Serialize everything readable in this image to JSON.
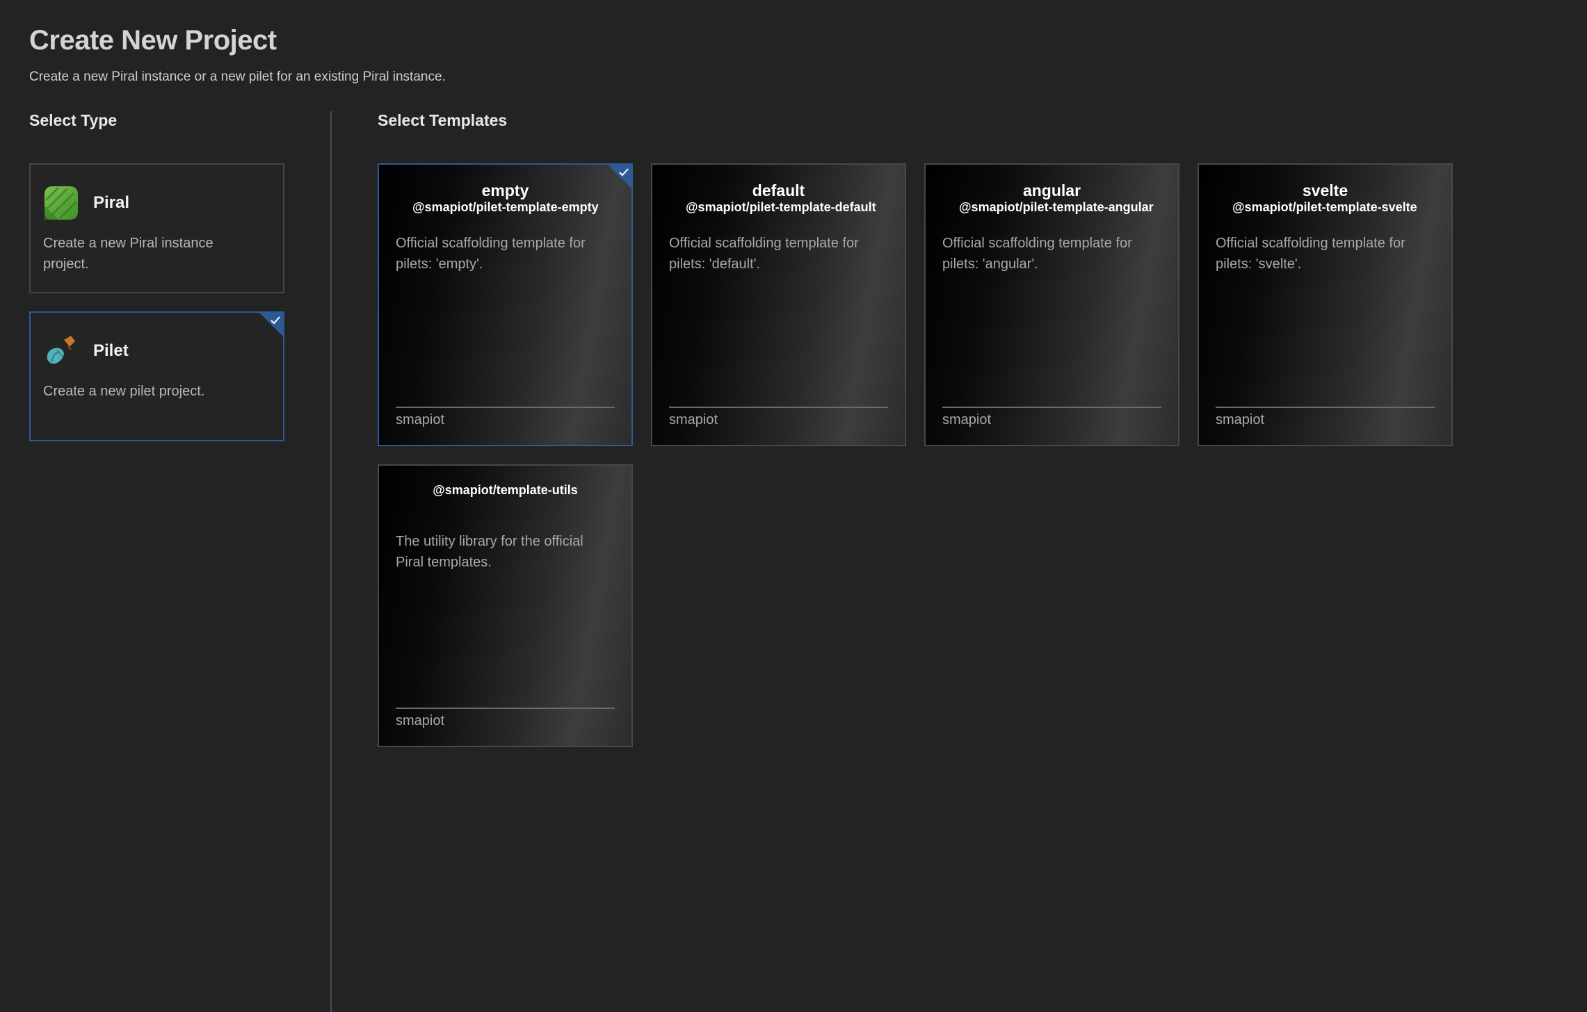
{
  "header": {
    "title": "Create New Project",
    "subtitle": "Create a new Piral instance or a new pilet for an existing Piral instance."
  },
  "type_section": {
    "title": "Select Type",
    "items": [
      {
        "name": "Piral",
        "description": "Create a new Piral instance project.",
        "selected": false,
        "icon": "piral-logo-icon"
      },
      {
        "name": "Pilet",
        "description": "Create a new pilet project.",
        "selected": true,
        "icon": "pilet-logo-icon"
      }
    ]
  },
  "template_section": {
    "title": "Select Templates",
    "items": [
      {
        "name": "empty",
        "package": "@smapiot/pilet-template-empty",
        "description": "Official scaffolding template for pilets: 'empty'.",
        "author": "smapiot",
        "selected": true
      },
      {
        "name": "default",
        "package": "@smapiot/pilet-template-default",
        "description": "Official scaffolding template for pilets: 'default'.",
        "author": "smapiot",
        "selected": false
      },
      {
        "name": "angular",
        "package": "@smapiot/pilet-template-angular",
        "description": "Official scaffolding template for pilets: 'angular'.",
        "author": "smapiot",
        "selected": false
      },
      {
        "name": "svelte",
        "package": "@smapiot/pilet-template-svelte",
        "description": "Official scaffolding template for pilets: 'svelte'.",
        "author": "smapiot",
        "selected": false
      },
      {
        "name": "",
        "package": "@smapiot/template-utils",
        "description": "The utility library for the official Piral templates.",
        "author": "smapiot",
        "selected": false
      }
    ]
  },
  "colors": {
    "background": "#232323",
    "accent": "#2d5a94",
    "piral_green": "#5aa83a",
    "pilet_teal": "#4fb3b8",
    "pilet_orange": "#c8782a"
  }
}
